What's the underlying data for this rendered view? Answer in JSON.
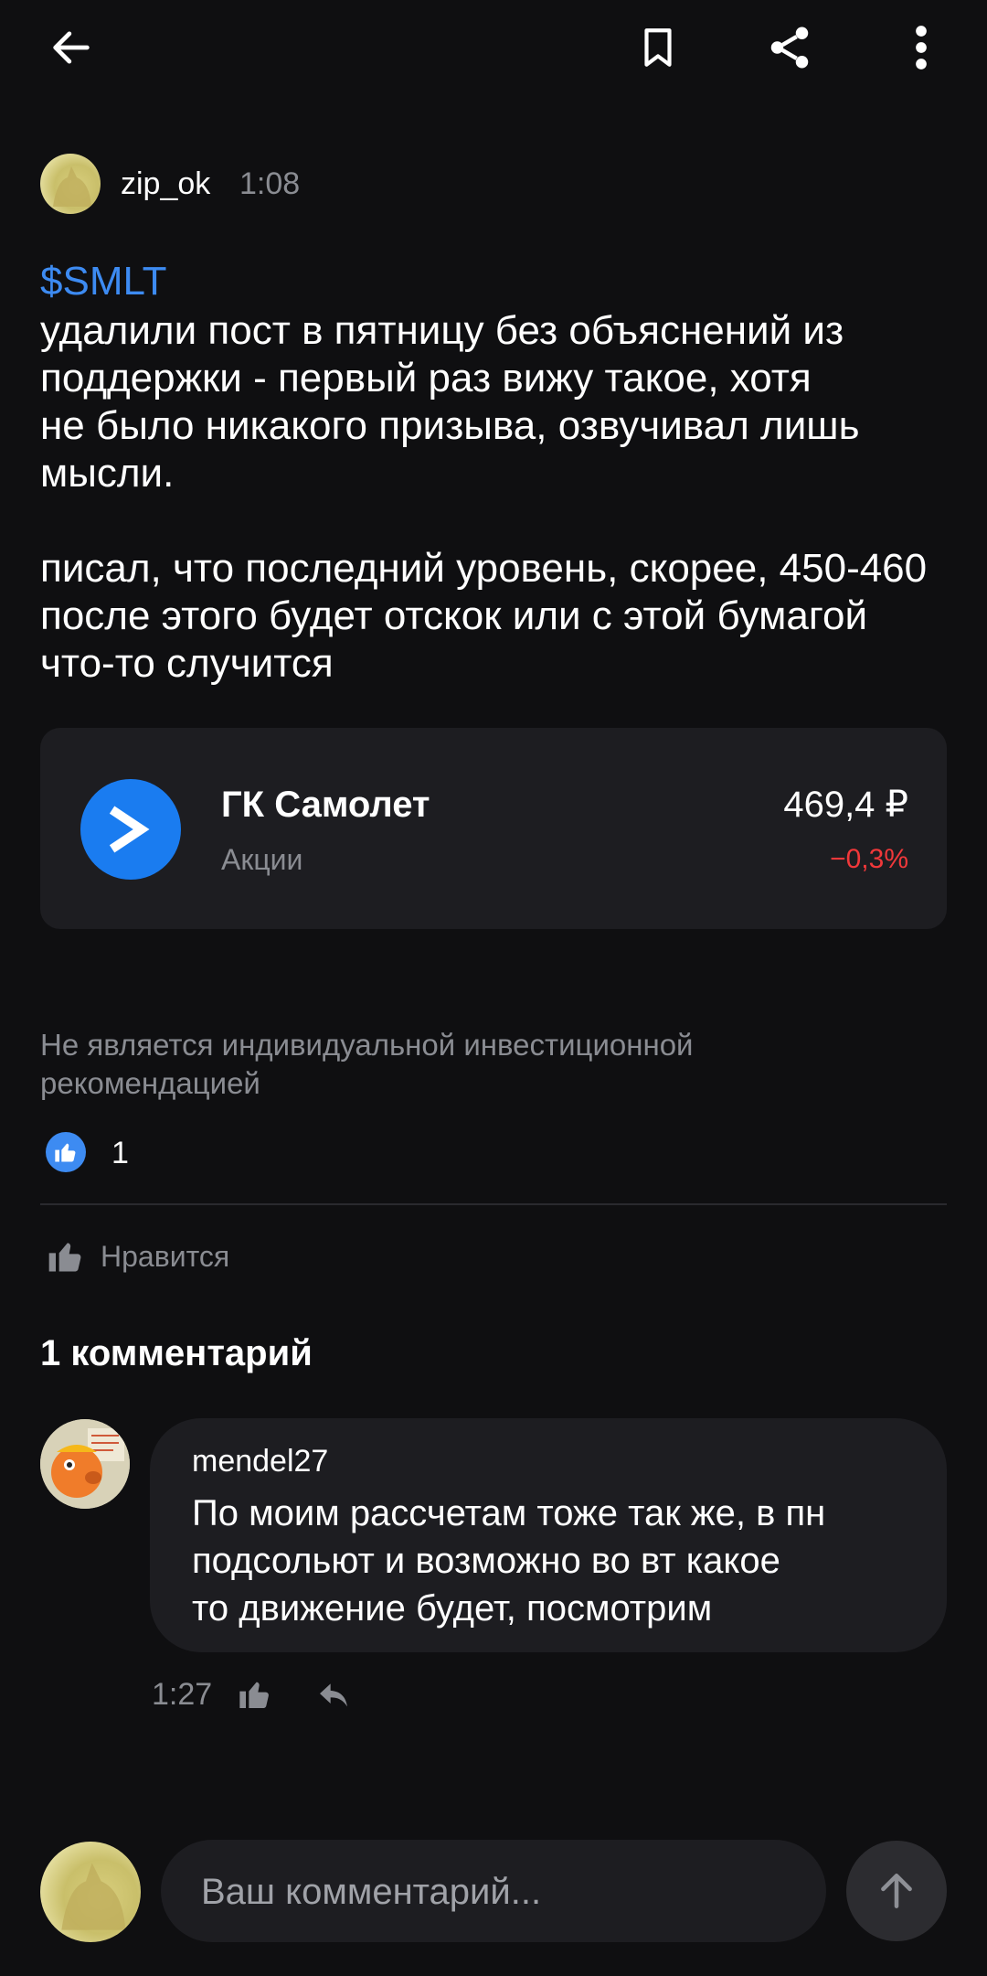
{
  "toolbar": {
    "back_icon": "arrow-left-icon",
    "bookmark_icon": "bookmark-icon",
    "share_icon": "share-icon",
    "more_icon": "more-vertical-icon"
  },
  "post": {
    "author": "zip_ok",
    "time": "1:08",
    "ticker": "$SMLT",
    "paragraph1_lines": [
      "удалили пост в пятницу без объяснений из",
      "поддержки - первый раз вижу такое, хотя",
      "не было никакого призыва, озвучивал лишь",
      "мысли."
    ],
    "paragraph2_lines": [
      "писал, что последний уровень, скорее, 450-460",
      "после этого будет отскок или с этой бумагой",
      "что-то случится"
    ]
  },
  "stock": {
    "name": "ГК Самолет",
    "type": "Акции",
    "price": "469,4 ₽",
    "change": "−0,3%",
    "logo_color": "#1a7cf0",
    "change_color": "#f0383a"
  },
  "disclaimer_lines": [
    "Не является индивидуальной инвестиционной",
    "рекомендацией"
  ],
  "reactions": {
    "count": "1"
  },
  "like_action": {
    "label": "Нравится"
  },
  "comments": {
    "header": "1 комментарий",
    "items": [
      {
        "author": "mendel27",
        "lines": [
          "По моим рассчетам тоже так же, в пн",
          "подсольют и возможно во вт какое",
          "то движение будет, посмотрим"
        ],
        "time": "1:27"
      }
    ]
  },
  "composer": {
    "placeholder": "Ваш комментарий..."
  },
  "colors": {
    "background": "#0f0f11",
    "card": "#1d1d21",
    "accent_blue": "#3d8bf2",
    "muted": "#8a8c92"
  }
}
